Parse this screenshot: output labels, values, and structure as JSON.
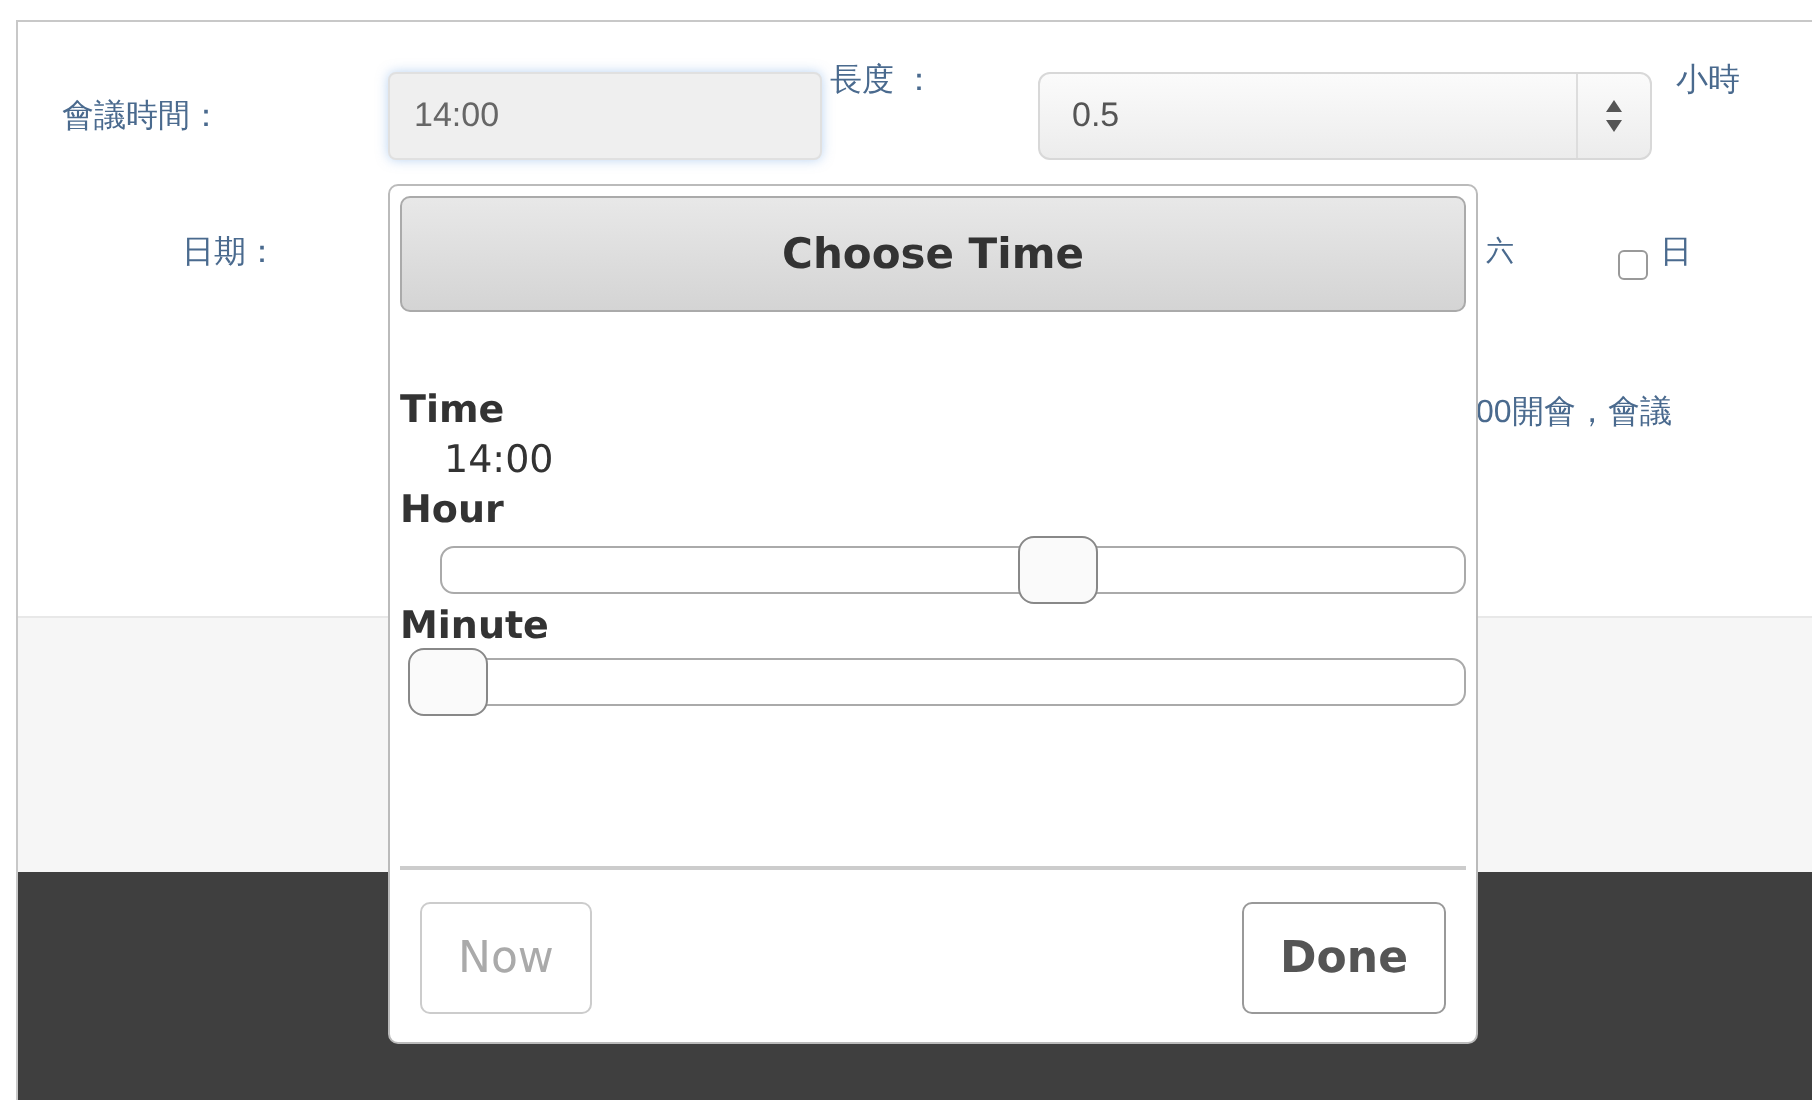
{
  "form": {
    "time_label": "會議時間：",
    "time_value": "14:00",
    "length_label": "長度 ：",
    "length_value": "0.5",
    "length_unit": "小時",
    "date_label": "日期：",
    "weekday_partial": "六",
    "weekday_options": [
      {
        "label": "日",
        "checked": false
      }
    ],
    "note_partial": "00開會，會議"
  },
  "time_picker": {
    "title": "Choose Time",
    "time_label": "Time",
    "time_value": "14:00",
    "sliders": [
      {
        "label": "Hour",
        "level": 0.61
      },
      {
        "label": "Minute",
        "level": 0
      }
    ],
    "buttons": [
      {
        "label": "Now",
        "disabled": true
      },
      {
        "label": "Done",
        "disabled": false
      }
    ]
  }
}
